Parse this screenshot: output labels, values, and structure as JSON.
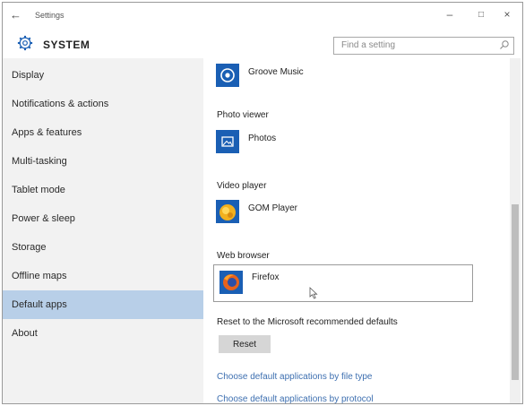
{
  "window": {
    "title": "Settings",
    "back_icon": "←",
    "minimize_icon": "–",
    "maximize_icon": "□",
    "close_icon": "×"
  },
  "header": {
    "icon": "gear-icon",
    "section_title": "SYSTEM",
    "search_placeholder": "Find a setting"
  },
  "sidebar": {
    "items": [
      {
        "label": "Display"
      },
      {
        "label": "Notifications & actions"
      },
      {
        "label": "Apps & features"
      },
      {
        "label": "Multi-tasking"
      },
      {
        "label": "Tablet mode"
      },
      {
        "label": "Power & sleep"
      },
      {
        "label": "Storage"
      },
      {
        "label": "Offline maps"
      },
      {
        "label": "Default apps",
        "selected": true
      },
      {
        "label": "About"
      }
    ]
  },
  "main": {
    "music_app": {
      "name": "Groove Music",
      "icon": "groove-music-icon",
      "icon_color": "#1a5fb4"
    },
    "photo_viewer": {
      "label": "Photo viewer",
      "app": "Photos",
      "icon": "photos-icon",
      "icon_color": "#1a5fb4"
    },
    "video_player": {
      "label": "Video player",
      "app": "GOM Player",
      "icon": "gom-player-icon"
    },
    "web_browser": {
      "label": "Web browser",
      "app": "Firefox",
      "icon": "firefox-icon"
    },
    "reset": {
      "label": "Reset to the Microsoft recommended defaults",
      "button_label": "Reset"
    },
    "links": {
      "by_file_type": "Choose default applications by file type",
      "by_protocol": "Choose default applications by protocol"
    }
  },
  "colors": {
    "accent": "#1a5fb4",
    "selected_nav": "#b8cfe8",
    "sidebar_bg": "#f2f2f2",
    "link": "#3d6fb0"
  }
}
